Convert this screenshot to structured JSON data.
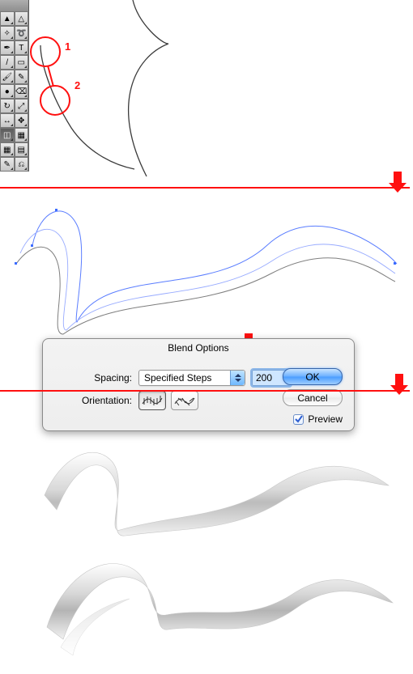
{
  "markers": {
    "one": "1",
    "two": "2"
  },
  "dialog": {
    "title": "Blend Options",
    "spacing_label": "Spacing:",
    "spacing_mode": "Specified Steps",
    "steps_value": "200",
    "orientation_label": "Orientation:",
    "ok_label": "OK",
    "cancel_label": "Cancel",
    "preview_label": "Preview",
    "preview_checked": true
  },
  "tools": {
    "rows": [
      [
        "selection-tool",
        "direct-selection-tool"
      ],
      [
        "magic-wand-tool",
        "lasso-tool"
      ],
      [
        "pen-tool",
        "type-tool"
      ],
      [
        "line-segment-tool",
        "rectangle-tool"
      ],
      [
        "paintbrush-tool",
        "pencil-tool"
      ],
      [
        "blob-brush-tool",
        "eraser-tool"
      ],
      [
        "rotate-tool",
        "scale-tool"
      ],
      [
        "width-tool",
        "free-transform-tool"
      ],
      [
        "shape-builder-tool",
        "perspective-grid-tool"
      ],
      [
        "mesh-tool",
        "gradient-tool"
      ],
      [
        "eyedropper-tool",
        "blend-tool"
      ]
    ],
    "selected": "shape-builder-tool"
  }
}
